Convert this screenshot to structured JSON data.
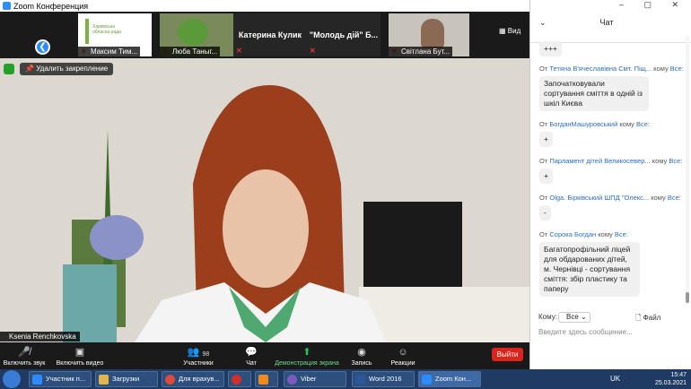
{
  "window": {
    "title": "Zoom Конференция"
  },
  "gallery": {
    "view_label": "Вид",
    "tiles": [
      {
        "name": "Максим Тим...",
        "logo_text": "Харківська обласна рада"
      },
      {
        "name": "Люба Таныг..."
      },
      {
        "name": "Катерина Кулик"
      },
      {
        "name": "\"Молодь дій\" Б..."
      },
      {
        "name": "Світлана Бут..."
      }
    ]
  },
  "main": {
    "unpin_label": "Удалить закрепление",
    "speaker_name": "Ksenia Renchkovska"
  },
  "toolbar": {
    "mute": "Включить звук",
    "video": "Включить видео",
    "participants": "Участники",
    "participants_count": "98",
    "chat": "Чат",
    "share": "Демонстрация экрана",
    "record": "Запись",
    "reactions": "Реакции",
    "leave": "Выйти"
  },
  "chat": {
    "title": "Чат",
    "top_bubble": "+++",
    "messages": [
      {
        "from_label": "От",
        "sender": "Тетяна В'ячеславівна Смт. Піщ...",
        "to_label": "кому",
        "recipient": "Все:",
        "text": "Започатковували сортування сміття в одній із шкіл Києва"
      },
      {
        "from_label": "От",
        "sender": "БогданМашуровський",
        "to_label": "кому",
        "recipient": "Все:",
        "text": "+"
      },
      {
        "from_label": "От",
        "sender": "Парламент дітей Великосевер...",
        "to_label": "кому",
        "recipient": "Все:",
        "text": "+"
      },
      {
        "from_label": "От",
        "sender": "Olga. Бірківський ШПД \"Олекс...",
        "to_label": "кому",
        "recipient": "Все:",
        "text": "-"
      },
      {
        "from_label": "От",
        "sender": "Сорока Богдан",
        "to_label": "кому",
        "recipient": "Все:",
        "text": "Багатопрофільний ліцей для обдарованих дітей, м. Чернівці - сортування сміття: збір пластику та паперу"
      }
    ],
    "to_label": "Кому:",
    "to_value": "Все",
    "file_label": "Файл",
    "input_placeholder": "Введите здесь сообщение..."
  },
  "taskbar": {
    "items": [
      {
        "label": "Участник п...",
        "color": "#2d8cff"
      },
      {
        "label": "Загрузки",
        "color": "#e0b64a"
      },
      {
        "label": "Для врахув...",
        "color": "#e04a3a"
      },
      {
        "label": "",
        "color": "#d0302a"
      },
      {
        "label": "",
        "color": "#f08a1a"
      },
      {
        "label": "Viber",
        "color": "#7d5bbe"
      },
      {
        "label": "Word 2016",
        "color": "#2b579a"
      },
      {
        "label": "Zoom Кон...",
        "color": "#2d8cff"
      }
    ],
    "lang": "UK",
    "time": "15:47",
    "date": "25.03.2021"
  }
}
